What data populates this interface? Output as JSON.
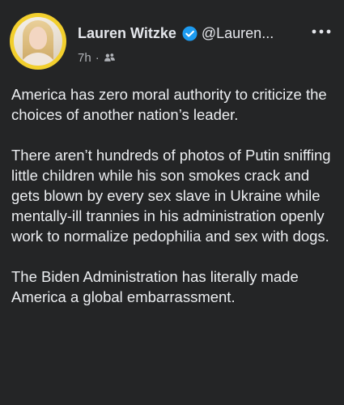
{
  "post": {
    "author_name": "Lauren Witzke",
    "author_handle": "@Lauren...",
    "timestamp": "7h",
    "separator": "·",
    "more_label": "···",
    "icons": {
      "verified": "verified-badge-icon",
      "audience": "friends-audience-icon",
      "more": "more-options-icon"
    },
    "paragraphs": [
      "America has zero moral authority to criticize the choices of another nation’s leader.",
      "There aren’t hundreds of photos of Putin sniffing little children while his son smokes crack and gets blown by every sex slave in Ukraine while mentally-ill trannies in his administration openly work to normalize pedophilia and sex with dogs.",
      "The Biden Administration has literally made America a global embarrassment."
    ]
  },
  "colors": {
    "background": "#242526",
    "text_primary": "#e4e6eb",
    "text_secondary": "#b0b3b8",
    "verified_blue": "#1d9bf0",
    "avatar_ring": "#f2cf2d"
  }
}
